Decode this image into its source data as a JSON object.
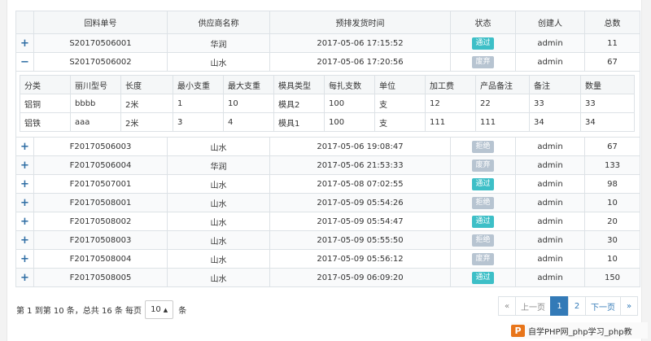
{
  "colors": {
    "pass": "#3dbfc7",
    "discard": "#b7c4d1",
    "reject": "#b7c4d1",
    "link": "#337ab7"
  },
  "main_table": {
    "headers": [
      "",
      "回料单号",
      "供应商名称",
      "预排发货时间",
      "状态",
      "创建人",
      "总数"
    ],
    "rows": [
      {
        "toggle": "+",
        "order": "S20170506001",
        "supplier": "华润",
        "time": "2017-05-06 17:15:52",
        "status": "通过",
        "status_type": "pass",
        "creator": "admin",
        "total": "11"
      },
      {
        "toggle": "−",
        "order": "S20170506002",
        "supplier": "山水",
        "time": "2017-05-06 17:20:56",
        "status": "废弃",
        "status_type": "discard",
        "creator": "admin",
        "total": "67"
      },
      {
        "toggle": "+",
        "order": "F20170506003",
        "supplier": "山水",
        "time": "2017-05-06 19:08:47",
        "status": "拒绝",
        "status_type": "reject",
        "creator": "admin",
        "total": "67"
      },
      {
        "toggle": "+",
        "order": "F20170506004",
        "supplier": "华润",
        "time": "2017-05-06 21:53:33",
        "status": "废弃",
        "status_type": "discard",
        "creator": "admin",
        "total": "133"
      },
      {
        "toggle": "+",
        "order": "F20170507001",
        "supplier": "山水",
        "time": "2017-05-08 07:02:55",
        "status": "通过",
        "status_type": "pass",
        "creator": "admin",
        "total": "98"
      },
      {
        "toggle": "+",
        "order": "F20170508001",
        "supplier": "山水",
        "time": "2017-05-09 05:54:26",
        "status": "拒绝",
        "status_type": "reject",
        "creator": "admin",
        "total": "10"
      },
      {
        "toggle": "+",
        "order": "F20170508002",
        "supplier": "山水",
        "time": "2017-05-09 05:54:47",
        "status": "通过",
        "status_type": "pass",
        "creator": "admin",
        "total": "20"
      },
      {
        "toggle": "+",
        "order": "F20170508003",
        "supplier": "山水",
        "time": "2017-05-09 05:55:50",
        "status": "拒绝",
        "status_type": "reject",
        "creator": "admin",
        "total": "30"
      },
      {
        "toggle": "+",
        "order": "F20170508004",
        "supplier": "山水",
        "time": "2017-05-09 05:56:12",
        "status": "废弃",
        "status_type": "discard",
        "creator": "admin",
        "total": "10"
      },
      {
        "toggle": "+",
        "order": "F20170508005",
        "supplier": "山水",
        "time": "2017-05-09 06:09:20",
        "status": "通过",
        "status_type": "pass",
        "creator": "admin",
        "total": "150"
      }
    ]
  },
  "sub_table": {
    "headers": [
      "分类",
      "丽川型号",
      "长度",
      "最小支重",
      "最大支重",
      "模具类型",
      "每扎支数",
      "单位",
      "加工费",
      "产品备注",
      "备注",
      "数量"
    ],
    "rows": [
      [
        "铝铜",
        "bbbb",
        "2米",
        "1",
        "10",
        "模具2",
        "100",
        "支",
        "12",
        "22",
        "33",
        "33"
      ],
      [
        "铝铁",
        "aaa",
        "2米",
        "3",
        "4",
        "模具1",
        "100",
        "支",
        "111",
        "111",
        "34",
        "34"
      ]
    ]
  },
  "footer": {
    "info_prefix": "第 1 到第 10 条，总共 16 条 每页",
    "page_size": "10",
    "info_suffix": "条"
  },
  "pagination": {
    "first": "«",
    "prev": "上一页",
    "page1": "1",
    "page2": "2",
    "next": "下一页",
    "last": "»"
  },
  "watermark": {
    "logo": "P",
    "text": "自学PHP网_php学习_php教"
  }
}
